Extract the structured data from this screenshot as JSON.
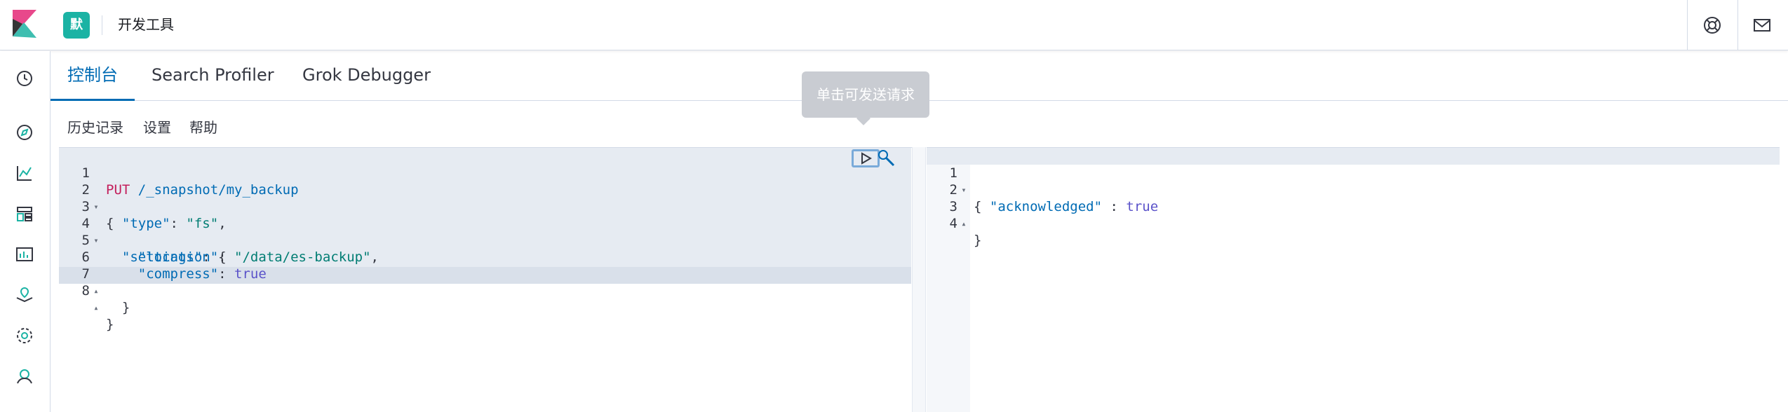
{
  "header": {
    "space_initial": "默",
    "app_title": "开发工具",
    "colors": {
      "space_badge": "#1bb3a4",
      "accent": "#006bb4"
    }
  },
  "sidebar": {
    "icons": [
      "clock-icon",
      "compass-icon",
      "visualize-icon",
      "dashboard-icon",
      "canvas-icon",
      "maps-icon",
      "ml-icon",
      "apm-icon"
    ]
  },
  "tabs": [
    {
      "label": "控制台",
      "active": true
    },
    {
      "label": "Search Profiler",
      "active": false
    },
    {
      "label": "Grok Debugger",
      "active": false
    }
  ],
  "toolbar": {
    "history": "历史记录",
    "settings": "设置",
    "help": "帮助"
  },
  "tooltip": {
    "text": "单击可发送请求"
  },
  "request_editor": {
    "lines": [
      {
        "num": "1",
        "fold": "",
        "method": "PUT",
        "path": " /_snapshot/my_backup"
      },
      {
        "num": "2",
        "fold": "▾",
        "text": "{"
      },
      {
        "num": "3",
        "fold": "",
        "indent": "  ",
        "key": "\"type\"",
        "sep": ": ",
        "str": "\"fs\"",
        "tail": ","
      },
      {
        "num": "4",
        "fold": "▾",
        "indent": "  ",
        "key": "\"settings\"",
        "sep": ": ",
        "tail": "{"
      },
      {
        "num": "5",
        "fold": "",
        "indent": "    ",
        "key": "\"location\"",
        "sep": ": ",
        "str": "\"/data/es-backup\"",
        "tail": ","
      },
      {
        "num": "6",
        "fold": "",
        "indent": "    ",
        "key": "\"compress\"",
        "sep": ": ",
        "bool": "true"
      },
      {
        "num": "7",
        "fold": "▴",
        "indent": "  ",
        "text": "}"
      },
      {
        "num": "8",
        "fold": "▴",
        "text": "}"
      }
    ]
  },
  "response_editor": {
    "lines": [
      {
        "num": "1",
        "fold": "▾",
        "text": "{"
      },
      {
        "num": "2",
        "fold": "",
        "indent": "  ",
        "key": "\"acknowledged\"",
        "sep": " : ",
        "bool": "true"
      },
      {
        "num": "3",
        "fold": "▴",
        "text": "}"
      },
      {
        "num": "4",
        "fold": "",
        "text": ""
      }
    ]
  }
}
